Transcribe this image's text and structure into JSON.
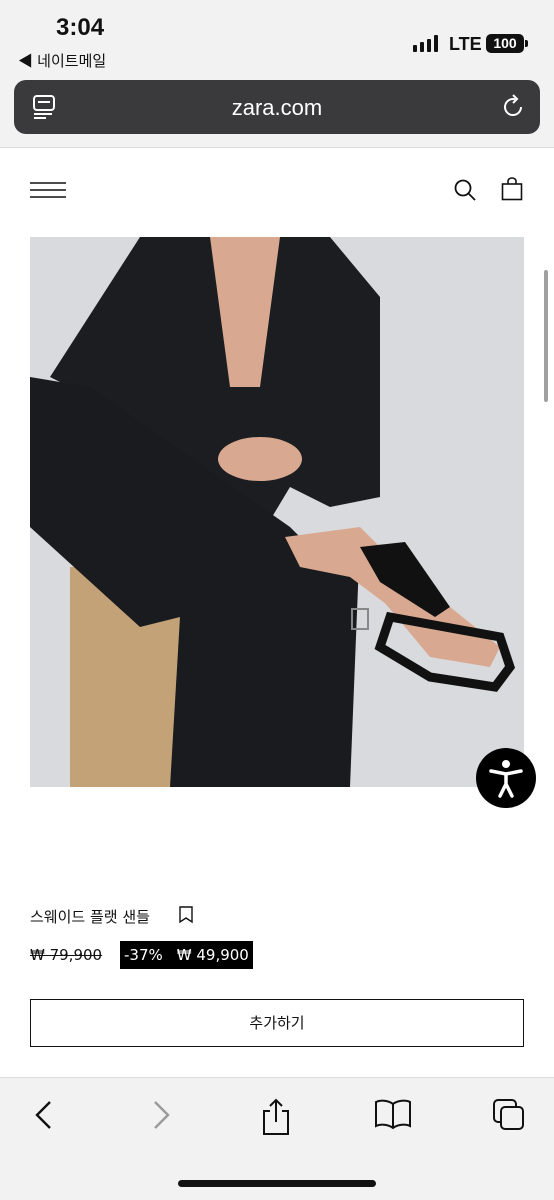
{
  "status_bar": {
    "time": "3:04",
    "back_app": "◀ 네이트메일",
    "network": "LTE",
    "battery": "100"
  },
  "browser": {
    "url": "zara.com",
    "reader_icon": "reader-icon",
    "reload_icon": "reload-icon"
  },
  "site_header": {
    "menu_icon": "hamburger-icon",
    "search_icon": "search-icon",
    "bag_icon": "shopping-bag-icon"
  },
  "product": {
    "name": "스웨이드 플랫 샌들",
    "original_price": "₩ 79,900",
    "discount": "-37%",
    "sale_price": "₩ 49,900",
    "add_button": "추가하기",
    "bookmark_icon": "bookmark-icon"
  },
  "toolbar": {
    "icons": [
      "back-arrow-icon",
      "forward-arrow-icon",
      "share-icon",
      "bookmarks-icon",
      "tabs-icon"
    ]
  },
  "colors": {
    "url_bar": "#3a3a3c",
    "chrome_bg": "#f2f2f2",
    "price_box": "#000000",
    "accessibility_button": "#000000"
  }
}
